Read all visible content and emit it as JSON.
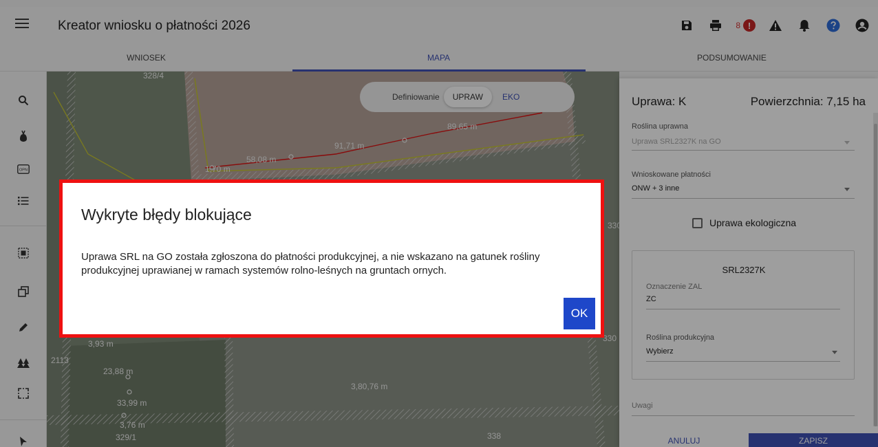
{
  "header": {
    "title": "Kreator wniosku o płatności 2026",
    "error_count": "8",
    "error_symbol": "!"
  },
  "tabs": [
    {
      "label": "WNIOSEK"
    },
    {
      "label": "MAPA"
    },
    {
      "label": "PODSUMOWANIE"
    }
  ],
  "map": {
    "mode_label": "Definiowanie",
    "mode_options": [
      "UPRAW",
      "EKO"
    ],
    "labels": [
      "89,65 m",
      "91,71 m",
      "58,08 m",
      "1,70 m",
      "330",
      "2113",
      "23,88 m",
      "3,93 m",
      "3,80,76 m",
      "33,99 m",
      "3,76 m",
      "329/1",
      "338",
      "328/4",
      "330"
    ]
  },
  "panel": {
    "crop_label": "Uprawa: K",
    "area_label": "Powierzchnia: 7,15 ha",
    "plant_label": "Roślina uprawna",
    "plant_value": "Uprawa SRL2327K na GO",
    "payments_label": "Wnioskowane płatności",
    "payments_value": "ONW + 3 inne",
    "eco_label": "Uprawa ekologiczna",
    "card_title": "SRL2327K",
    "zal_label": "Oznaczenie ZAL",
    "zal_value": "ZC",
    "prod_label": "Roślina produkcyjna",
    "prod_value": "Wybierz",
    "notes_label": "Uwagi",
    "cancel_label": "ANULUJ",
    "save_label": "ZAPISZ"
  },
  "dialog": {
    "title": "Wykryte błędy blokujące",
    "message": "Uprawa SRL na GO została zgłoszona do płatności produkcyjnej, a nie wskazano na gatunek rośliny produkcyjnej uprawianej w ramach systemów rolno-leśnych na gruntach ornych.",
    "ok_label": "OK"
  },
  "colors": {
    "accent": "#3f51b5",
    "error": "#c62828",
    "highlight_border": "#ee1111",
    "ok_button": "#1e47c9",
    "save_button": "#3f51b5"
  }
}
